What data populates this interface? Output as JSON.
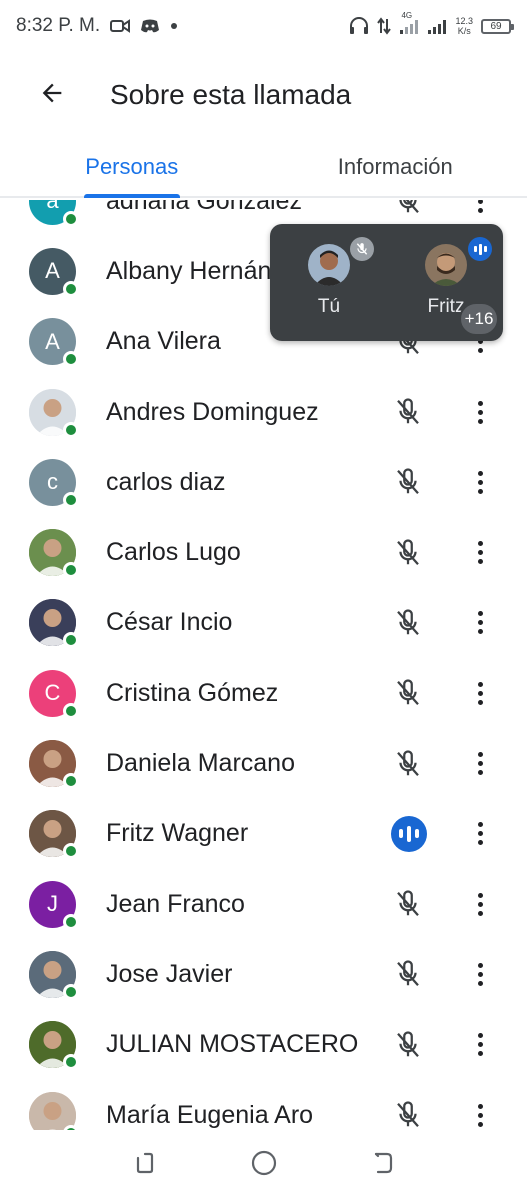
{
  "status_bar": {
    "time": "8:32 P. M.",
    "network_label": "4G",
    "speed_value": "12.3",
    "speed_unit": "K/s",
    "battery": "69"
  },
  "header": {
    "title": "Sobre esta llamada",
    "back_icon": "arrow-back-icon"
  },
  "tabs": [
    {
      "label": "Personas",
      "active": true
    },
    {
      "label": "Información",
      "active": false
    }
  ],
  "participants": [
    {
      "name": "adriana Gonzalez",
      "initial": "a",
      "avatar_color": "#129eaf",
      "photo": false,
      "speaking": false
    },
    {
      "name": "Albany Hernández",
      "initial": "A",
      "avatar_color": "#455a64",
      "photo": false,
      "speaking": false
    },
    {
      "name": "Ana Vilera",
      "initial": "A",
      "avatar_color": "#78909c",
      "photo": false,
      "speaking": false
    },
    {
      "name": "Andres Dominguez",
      "initial": "",
      "avatar_color": "#d7dde3",
      "photo": true,
      "speaking": false
    },
    {
      "name": "carlos diaz",
      "initial": "c",
      "avatar_color": "#78909c",
      "photo": false,
      "speaking": false
    },
    {
      "name": "Carlos Lugo",
      "initial": "",
      "avatar_color": "#6b8f4e",
      "photo": true,
      "speaking": false
    },
    {
      "name": "César Incio",
      "initial": "",
      "avatar_color": "#3a3f5a",
      "photo": true,
      "speaking": false
    },
    {
      "name": "Cristina Gómez",
      "initial": "C",
      "avatar_color": "#ec407a",
      "photo": false,
      "speaking": false
    },
    {
      "name": "Daniela Marcano",
      "initial": "",
      "avatar_color": "#8a5a44",
      "photo": true,
      "speaking": false
    },
    {
      "name": "Fritz Wagner",
      "initial": "",
      "avatar_color": "#6d5645",
      "photo": true,
      "speaking": true
    },
    {
      "name": "Jean Franco",
      "initial": "J",
      "avatar_color": "#7b1fa2",
      "photo": false,
      "speaking": false
    },
    {
      "name": "Jose Javier",
      "initial": "",
      "avatar_color": "#5b6b7a",
      "photo": true,
      "speaking": false
    },
    {
      "name": "JULIAN MOSTACERO",
      "initial": "",
      "avatar_color": "#4e6b2a",
      "photo": true,
      "speaking": false
    },
    {
      "name": "María Eugenia Aro",
      "initial": "",
      "avatar_color": "#c9b8aa",
      "photo": true,
      "speaking": false
    }
  ],
  "pip": {
    "self_label": "Tú",
    "other_label": "Fritz",
    "extra_count": "+16"
  },
  "colors": {
    "accent": "#1a73e8",
    "online": "#1e8e3e",
    "speaking": "#1967d2"
  },
  "icons": {
    "mic_off": "mic-off-icon",
    "more": "more-vert-icon",
    "nav_recents": "recents-icon",
    "nav_home": "home-icon",
    "nav_back": "back-icon"
  }
}
